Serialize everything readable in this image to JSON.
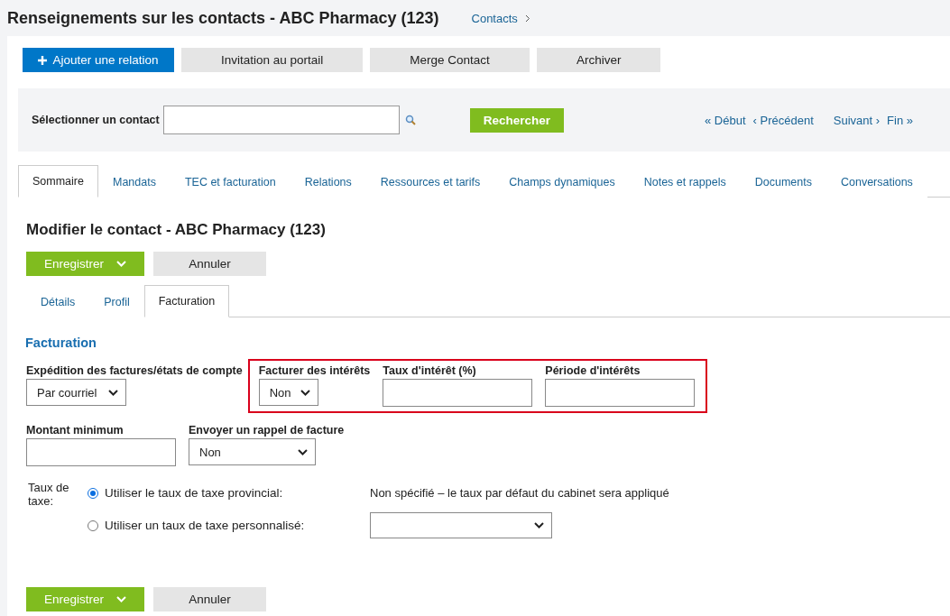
{
  "header": {
    "title": "Renseignements sur les contacts - ABC Pharmacy (123)",
    "breadcrumb": "Contacts"
  },
  "actions": [
    {
      "label": "Ajouter une relation",
      "kind": "primary"
    },
    {
      "label": "Invitation au portail",
      "kind": "secondary"
    },
    {
      "label": "Merge Contact",
      "kind": "secondary"
    },
    {
      "label": "Archiver",
      "kind": "secondary"
    }
  ],
  "search": {
    "label": "Sélectionner un contact",
    "button": "Rechercher",
    "nav": [
      "« Début",
      "‹ Précédent",
      "Suivant ›",
      "Fin »"
    ]
  },
  "tabs": [
    {
      "label": "Sommaire",
      "selected": true
    },
    {
      "label": "Mandats",
      "selected": false
    },
    {
      "label": "TEC et facturation",
      "selected": false
    },
    {
      "label": "Relations",
      "selected": false
    },
    {
      "label": "Ressources et tarifs",
      "selected": false
    },
    {
      "label": "Champs dynamiques",
      "selected": false
    },
    {
      "label": "Notes et rappels",
      "selected": false
    },
    {
      "label": "Documents",
      "selected": false
    },
    {
      "label": "Conversations",
      "selected": false
    }
  ],
  "form": {
    "title": "Modifier le contact - ABC Pharmacy (123)",
    "top_buttons": {
      "save": "Enregistrer",
      "cancel": "Annuler"
    },
    "subtabs": [
      {
        "label": "Détails",
        "selected": false
      },
      {
        "label": "Profil",
        "selected": false
      },
      {
        "label": "Facturation",
        "selected": true
      }
    ],
    "section": "Facturation",
    "row_1": {
      "fields": [
        {
          "kind": "select",
          "label": "Expédition des factures/états de compte",
          "value": "Par courriel"
        }
      ],
      "highlight": {
        "fields": [
          {
            "kind": "select",
            "label": "Facturer des intérêts",
            "value": "Non"
          },
          {
            "kind": "input",
            "label": "Taux d'intérêt (%)"
          },
          {
            "kind": "input",
            "label": "Période d'intérêts"
          }
        ]
      }
    },
    "row_2": {
      "fields": [
        {
          "kind": "input",
          "label": "Montant minimum"
        },
        {
          "kind": "select",
          "label": "Envoyer un rappel de facture",
          "value": "Non"
        }
      ]
    },
    "tax": {
      "label": "Taux de taxe:",
      "options": [
        {
          "label": "Utiliser le taux de taxe provincial:",
          "selected": true,
          "kind": "text",
          "text": "Non spécifié – le taux par défaut du cabinet sera appliqué"
        },
        {
          "label": "Utiliser un taux de taxe personnalisé:",
          "selected": false,
          "kind": "select"
        }
      ]
    },
    "bottom_buttons": {
      "save": "Enregistrer",
      "cancel": "Annuler"
    }
  }
}
